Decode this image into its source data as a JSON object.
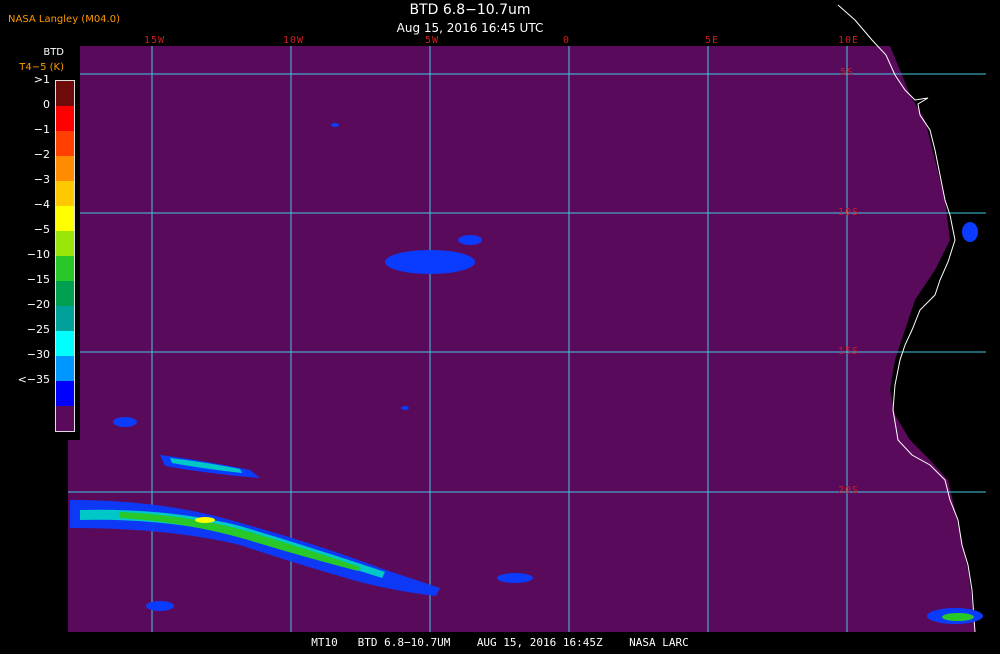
{
  "header": {
    "title": "BTD 6.8−10.7um",
    "subtitle": "Aug 15, 2016 16:45 UTC",
    "source": "NASA Langley (M04.0)"
  },
  "legend": {
    "title": "BTD",
    "unit": "T4−5 (K)",
    "classes": [
      {
        "label": ">1",
        "color": "#6e0a0a"
      },
      {
        "label": "0",
        "color": "#ff0000"
      },
      {
        "label": "−1",
        "color": "#ff4000"
      },
      {
        "label": "−2",
        "color": "#ff8c00"
      },
      {
        "label": "−3",
        "color": "#ffc800"
      },
      {
        "label": "−4",
        "color": "#ffff00"
      },
      {
        "label": "−5",
        "color": "#9be60a"
      },
      {
        "label": "−10",
        "color": "#28c828"
      },
      {
        "label": "−15",
        "color": "#00a050"
      },
      {
        "label": "−20",
        "color": "#00a09b"
      },
      {
        "label": "−25",
        "color": "#00ffff"
      },
      {
        "label": "−30",
        "color": "#0096ff"
      },
      {
        "label": "<−35",
        "color": "#0000ff"
      },
      {
        "label": "",
        "color": "#5a0a5a"
      }
    ]
  },
  "map": {
    "background_color": "#5a0a5a",
    "grid_color": "#40c8e0",
    "longitude_labels": [
      "15W",
      "10W",
      "5W",
      "0",
      "5E",
      "10E"
    ],
    "latitude_labels": [
      "5S",
      "10S",
      "15S",
      "20S"
    ]
  },
  "footer": {
    "text": "MT10   BTD 6.8−10.7UM    AUG 15, 2016 16:45Z    NASA LARC"
  }
}
